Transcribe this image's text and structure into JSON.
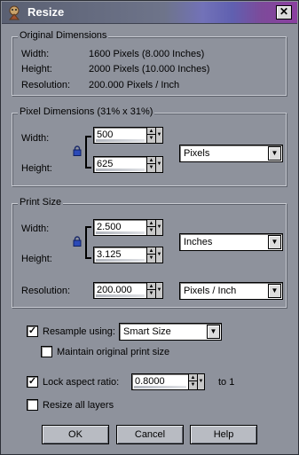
{
  "window": {
    "title": "Resize",
    "close_glyph": "✕"
  },
  "original": {
    "title": "Original Dimensions",
    "width_label": "Width:",
    "width_value": "1600 Pixels (8.000 Inches)",
    "height_label": "Height:",
    "height_value": "2000 Pixels (10.000 Inches)",
    "resolution_label": "Resolution:",
    "resolution_value": "200.000 Pixels / Inch"
  },
  "pixel": {
    "title": "Pixel Dimensions (31% x 31%)",
    "width_label": "Width:",
    "width_value": "500",
    "height_label": "Height:",
    "height_value": "625",
    "unit": "Pixels"
  },
  "print": {
    "title": "Print Size",
    "width_label": "Width:",
    "width_value": "2.500",
    "height_label": "Height:",
    "height_value": "3.125",
    "unit": "Inches",
    "resolution_label": "Resolution:",
    "resolution_value": "200.000",
    "resolution_unit": "Pixels / Inch"
  },
  "options": {
    "resample_label": "Resample using:",
    "resample_checked": true,
    "resample_method": "Smart Size",
    "maintain_label": "Maintain original print size",
    "maintain_checked": false,
    "lock_label": "Lock aspect ratio:",
    "lock_checked": true,
    "lock_value": "0.8000",
    "lock_suffix": "to 1",
    "resize_layers_label": "Resize all layers",
    "resize_layers_checked": false
  },
  "buttons": {
    "ok": "OK",
    "cancel": "Cancel",
    "help": "Help"
  },
  "icons": {
    "app": "app-icon",
    "close": "close-icon",
    "lock": "lock-icon",
    "spin": "spinner-arrows-icon",
    "dropdown": "chevron-down-icon"
  },
  "colors": {
    "background": "#8e929c",
    "titlebar_accent": "#8b3fa0"
  }
}
